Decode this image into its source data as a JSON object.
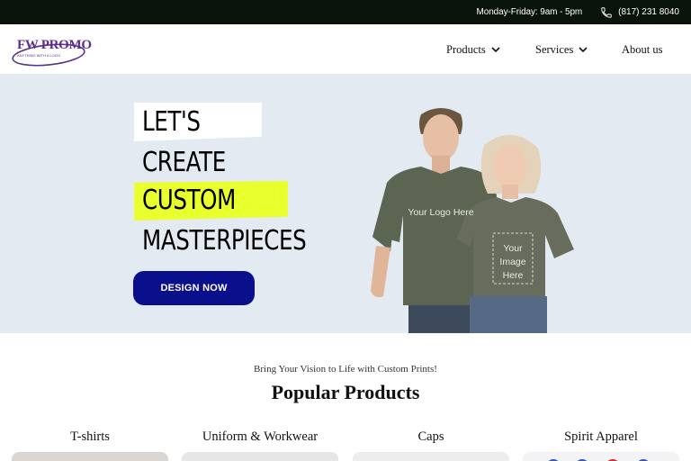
{
  "topbar": {
    "hours": "Monday-Friday: 9am - 5pm",
    "phone": "(817) 231 8040",
    "icon": "phone-icon"
  },
  "header": {
    "logo_text": "FW PROMO",
    "logo_sub": "ANYTHING WITH A LOGO",
    "nav": [
      {
        "label": "Products",
        "icon": "chevron-down-icon"
      },
      {
        "label": "Services",
        "icon": "chevron-down-icon"
      },
      {
        "label": "About us"
      }
    ]
  },
  "hero": {
    "lines": [
      "LET'S",
      "CREATE",
      "CUSTOM",
      "MASTERPIECES"
    ],
    "cta": "DESIGN NOW",
    "shirt_man": "Your Logo Here",
    "shirt_woman": [
      "Your",
      "Image",
      "Here"
    ],
    "colors": {
      "highlight": "#e9ff2e",
      "cta_bg": "#0a0f8c",
      "hero_bg": "#e3eaf2"
    }
  },
  "products": {
    "tagline": "Bring Your Vision to Life with Custom Prints!",
    "title": "Popular Products",
    "categories": [
      "T-shirts",
      "Uniform & Workwear",
      "Caps",
      "Spirit Apparel"
    ]
  }
}
